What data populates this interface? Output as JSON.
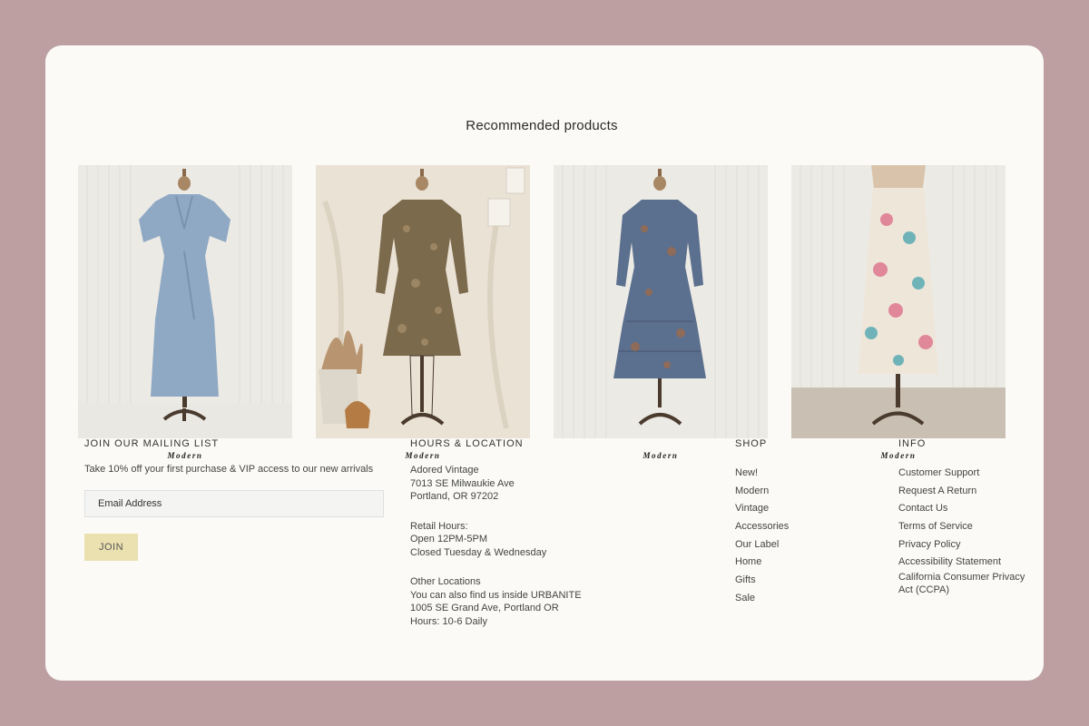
{
  "recommended": {
    "title": "Recommended products",
    "products": [
      {
        "tag": "Modern"
      },
      {
        "tag": "Modern"
      },
      {
        "tag": "Modern"
      },
      {
        "tag": "Modern"
      }
    ]
  },
  "mailing": {
    "heading": "JOIN OUR MAILING LIST",
    "blurb": "Take 10% off your first purchase & VIP access to our new arrivals",
    "email_placeholder": "Email Address",
    "join_label": "JOIN"
  },
  "hours": {
    "heading": "HOURS & LOCATION",
    "address": [
      "Adored Vintage",
      "7013 SE Milwaukie Ave",
      "Portland, OR 97202"
    ],
    "retail": [
      "Retail Hours:",
      "Open 12PM-5PM",
      "Closed Tuesday & Wednesday"
    ],
    "other": [
      "Other Locations",
      "You can also find us inside URBANITE",
      "1005 SE Grand Ave, Portland OR",
      "Hours: 10-6 Daily"
    ]
  },
  "shop": {
    "heading": "SHOP",
    "items": [
      "New!",
      "Modern",
      "Vintage",
      "Accessories",
      "Our Label",
      "Home",
      "Gifts",
      "Sale"
    ]
  },
  "info": {
    "heading": "INFO",
    "items": [
      "Customer Support",
      "Request A Return",
      "Contact Us",
      "Terms of Service",
      "Privacy Policy",
      "Accessibility Statement",
      "California Consumer Privacy Act (CCPA)"
    ]
  },
  "colors": {
    "page_bg": "#bd9fa1",
    "card_bg": "#fbfaf6",
    "join_bg": "#ebe1b0"
  }
}
